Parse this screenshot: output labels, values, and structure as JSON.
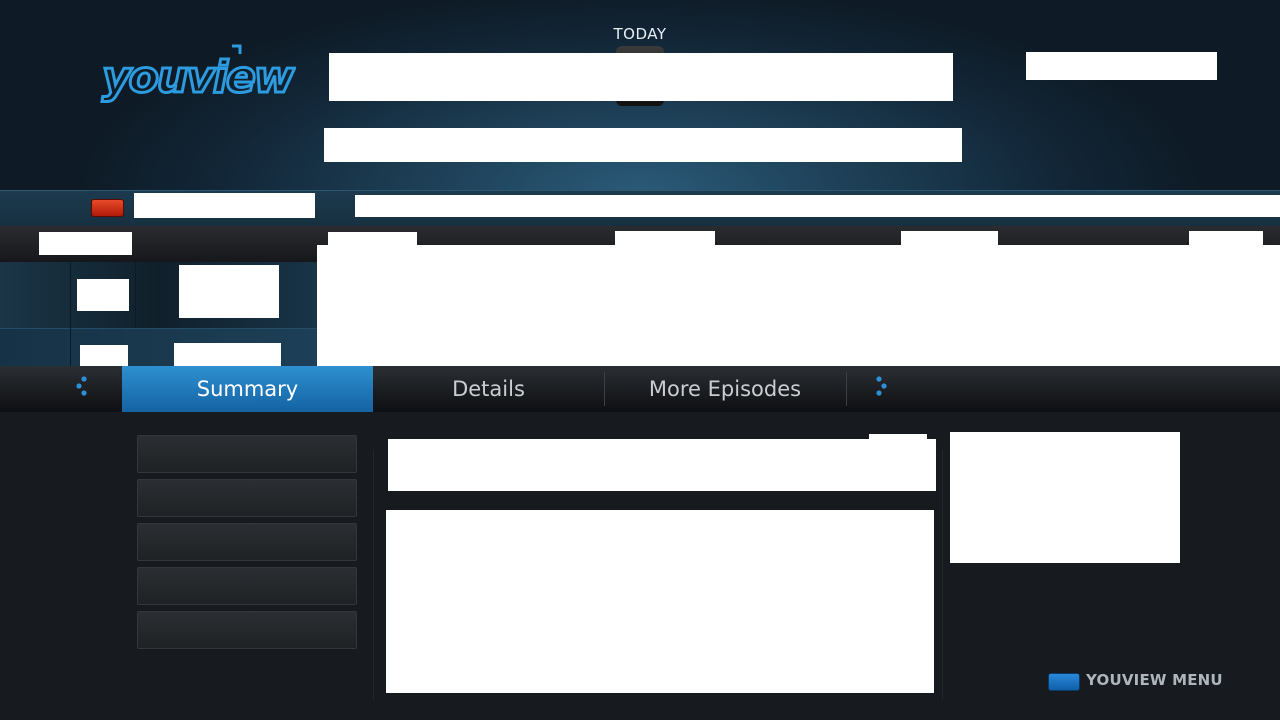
{
  "header": {
    "brand": "youview",
    "today_label": "TODAY"
  },
  "tabs": [
    {
      "label": "Summary",
      "selected": true
    },
    {
      "label": "Details",
      "selected": false
    },
    {
      "label": "More Episodes",
      "selected": false
    }
  ],
  "footer": {
    "menu_label": "YOUVIEW MENU"
  },
  "colors": {
    "accent_blue": "#1e7cc0",
    "red_key": "#d0301a",
    "background": "#15191e"
  },
  "icons": {
    "left_tab_arrow": "dots-left-icon",
    "right_tab_arrow": "dots-right-icon"
  }
}
